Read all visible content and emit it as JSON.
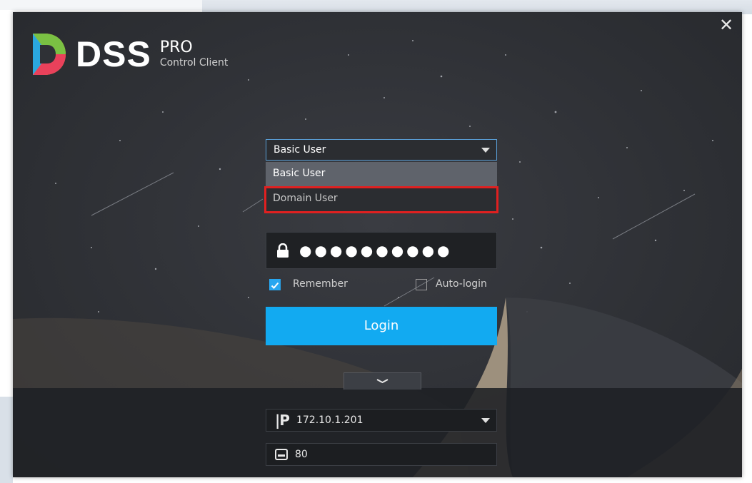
{
  "app": {
    "brand": "DSS",
    "edition": "PRO",
    "subtitle": "Control Client",
    "close_label": "✕"
  },
  "login_form": {
    "user_type": {
      "selected": "Basic User",
      "options": [
        "Basic User",
        "Domain User"
      ],
      "highlighted_option": "Domain User"
    },
    "password": {
      "masked_value": "●●●●●●●●●●"
    },
    "remember": {
      "label": "Remember",
      "checked": true
    },
    "auto_login": {
      "label": "Auto-login",
      "checked": false
    },
    "login_button": "Login"
  },
  "server": {
    "ip_address": "172.10.1.201",
    "port": "80"
  },
  "colors": {
    "accent": "#12aaf1",
    "highlight_border": "#e02020",
    "window_bg": "#2f3136"
  }
}
